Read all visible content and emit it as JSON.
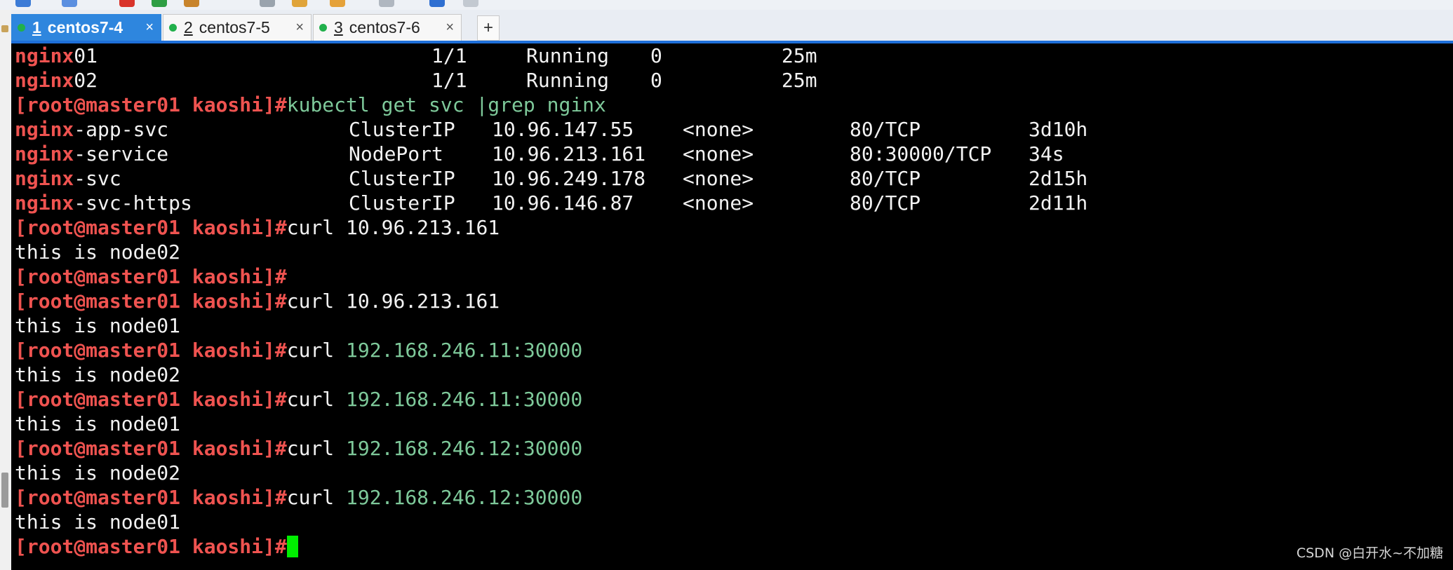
{
  "tabs": [
    {
      "num": "1",
      "label": "centos7-4",
      "active": true,
      "close": "×"
    },
    {
      "num": "2",
      "label": "centos7-5",
      "active": false,
      "close": "×"
    },
    {
      "num": "3",
      "label": "centos7-6",
      "active": false,
      "close": "×"
    }
  ],
  "tab_add": "+",
  "terminal": {
    "pods": [
      {
        "match": "nginx",
        "rest": "01",
        "ready": "1/1",
        "status": "Running",
        "restarts": "0",
        "age": "25m"
      },
      {
        "match": "nginx",
        "rest": "02",
        "ready": "1/1",
        "status": "Running",
        "restarts": "0",
        "age": "25m"
      }
    ],
    "prompt": "[root@master01 kaoshi]#",
    "svc_command": "kubectl get svc |grep nginx",
    "services": [
      {
        "match": "nginx",
        "rest": "-app-svc",
        "type": "ClusterIP",
        "cluster_ip": "10.96.147.55",
        "external_ip": "<none>",
        "ports": "80/TCP",
        "age": "3d10h"
      },
      {
        "match": "nginx",
        "rest": "-service",
        "type": "NodePort",
        "cluster_ip": "10.96.213.161",
        "external_ip": "<none>",
        "ports": "80:30000/TCP",
        "age": "34s"
      },
      {
        "match": "nginx",
        "rest": "-svc",
        "type": "ClusterIP",
        "cluster_ip": "10.96.249.178",
        "external_ip": "<none>",
        "ports": "80/TCP",
        "age": "2d15h"
      },
      {
        "match": "nginx",
        "rest": "-svc-https",
        "type": "ClusterIP",
        "cluster_ip": "10.96.146.87",
        "external_ip": "<none>",
        "ports": "80/TCP",
        "age": "2d11h"
      }
    ],
    "curl_1": "curl 10.96.213.161",
    "out_1": "this is node02",
    "curl_2": "curl 10.96.213.161",
    "out_2": "this is node01",
    "curl_3_cmd": "curl ",
    "curl_3_addr": "192.168.246.11:30000",
    "out_3": "this is node02",
    "curl_4_cmd": "curl ",
    "curl_4_addr": "192.168.246.11:30000",
    "out_4": "this is node01",
    "curl_5_cmd": "curl ",
    "curl_5_addr": "192.168.246.12:30000",
    "out_5": "this is node02",
    "curl_6_cmd": "curl ",
    "curl_6_addr": "192.168.246.12:30000",
    "out_6": "this is node01"
  },
  "watermark": "CSDN @白开水~不加糖",
  "colors": {
    "terminal_bg": "#000000",
    "prompt": "#ef5350",
    "green_cmd": "#7ec99a",
    "cursor": "#00ee00",
    "active_tab": "#2e86de"
  }
}
